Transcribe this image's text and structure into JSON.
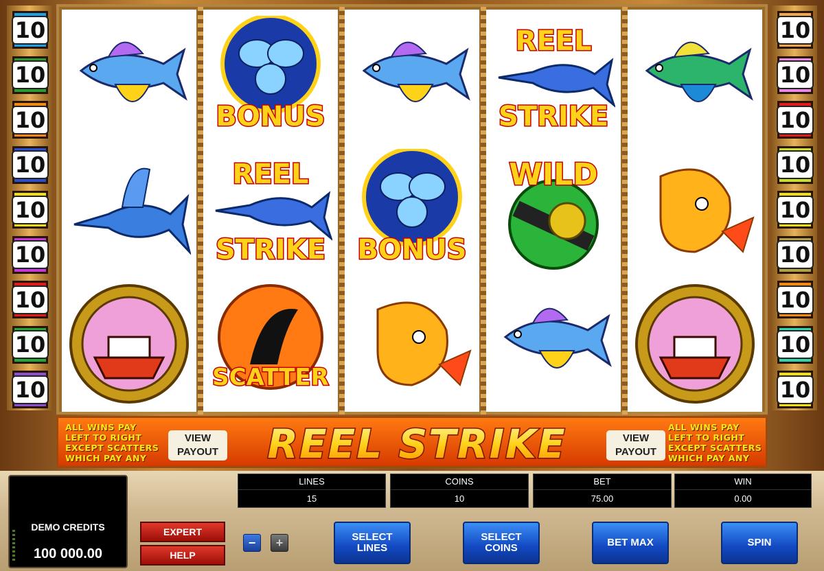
{
  "side_lines": {
    "left": [
      {
        "label": "10",
        "color": "#1ea0e6"
      },
      {
        "label": "10",
        "color": "#2b9a33"
      },
      {
        "label": "10",
        "color": "#f08a14"
      },
      {
        "label": "10",
        "color": "#2a4fcf"
      },
      {
        "label": "10",
        "color": "#f2df13"
      },
      {
        "label": "10",
        "color": "#c13ad8"
      },
      {
        "label": "10",
        "color": "#e01b1b"
      },
      {
        "label": "10",
        "color": "#22a83a"
      },
      {
        "label": "10",
        "color": "#8a4fd1"
      }
    ],
    "right": [
      {
        "label": "10",
        "color": "#f2a64a"
      },
      {
        "label": "10",
        "color": "#e68ae6"
      },
      {
        "label": "10",
        "color": "#e01b1b"
      },
      {
        "label": "10",
        "color": "#c9e02a"
      },
      {
        "label": "10",
        "color": "#f2df13"
      },
      {
        "label": "10",
        "color": "#b0a04a"
      },
      {
        "label": "10",
        "color": "#f08a14"
      },
      {
        "label": "10",
        "color": "#2fd4b0"
      },
      {
        "label": "10",
        "color": "#f2df13"
      }
    ]
  },
  "reels": [
    [
      "flying-fish",
      "marlin",
      "boat-porthole"
    ],
    [
      "bonus-propeller",
      "reel-strike-marlin",
      "scatter-marlin"
    ],
    [
      "flying-fish",
      "bonus-propeller",
      "mahi-mahi"
    ],
    [
      "reel-strike-marlin",
      "wild-fishing-reel",
      "flying-fish"
    ],
    [
      "tuna",
      "mahi-mahi",
      "boat-porthole"
    ]
  ],
  "symbol_text": {
    "bonus": "BONUS",
    "reel": "REEL",
    "strike": "STRIKE",
    "wild": "WILD",
    "scatter": "SCATTER"
  },
  "banner": {
    "rules_left": [
      "ALL WINS PAY",
      "LEFT TO RIGHT",
      "EXCEPT SCATTERS",
      "WHICH PAY ANY"
    ],
    "rules_right": [
      "ALL WINS PAY",
      "LEFT TO RIGHT",
      "EXCEPT SCATTERS",
      "WHICH PAY ANY"
    ],
    "view_line1": "VIEW",
    "view_line2": "PAYOUT",
    "logo_text": "REEL STRIKE"
  },
  "panel": {
    "credits_label": "DEMO CREDITS",
    "credits_value": "100 000.00",
    "expert_label": "EXPERT",
    "help_label": "HELP",
    "minus_label": "−",
    "plus_label": "+",
    "stats": {
      "lines": {
        "label": "LINES",
        "value": "15"
      },
      "coins": {
        "label": "COINS",
        "value": "10"
      },
      "bet": {
        "label": "BET",
        "value": "75.00"
      },
      "win": {
        "label": "WIN",
        "value": "0.00"
      }
    },
    "select_lines": [
      "SELECT",
      "LINES"
    ],
    "select_coins": [
      "SELECT",
      "COINS"
    ],
    "bet_max": "BET MAX",
    "spin": "SPIN"
  }
}
